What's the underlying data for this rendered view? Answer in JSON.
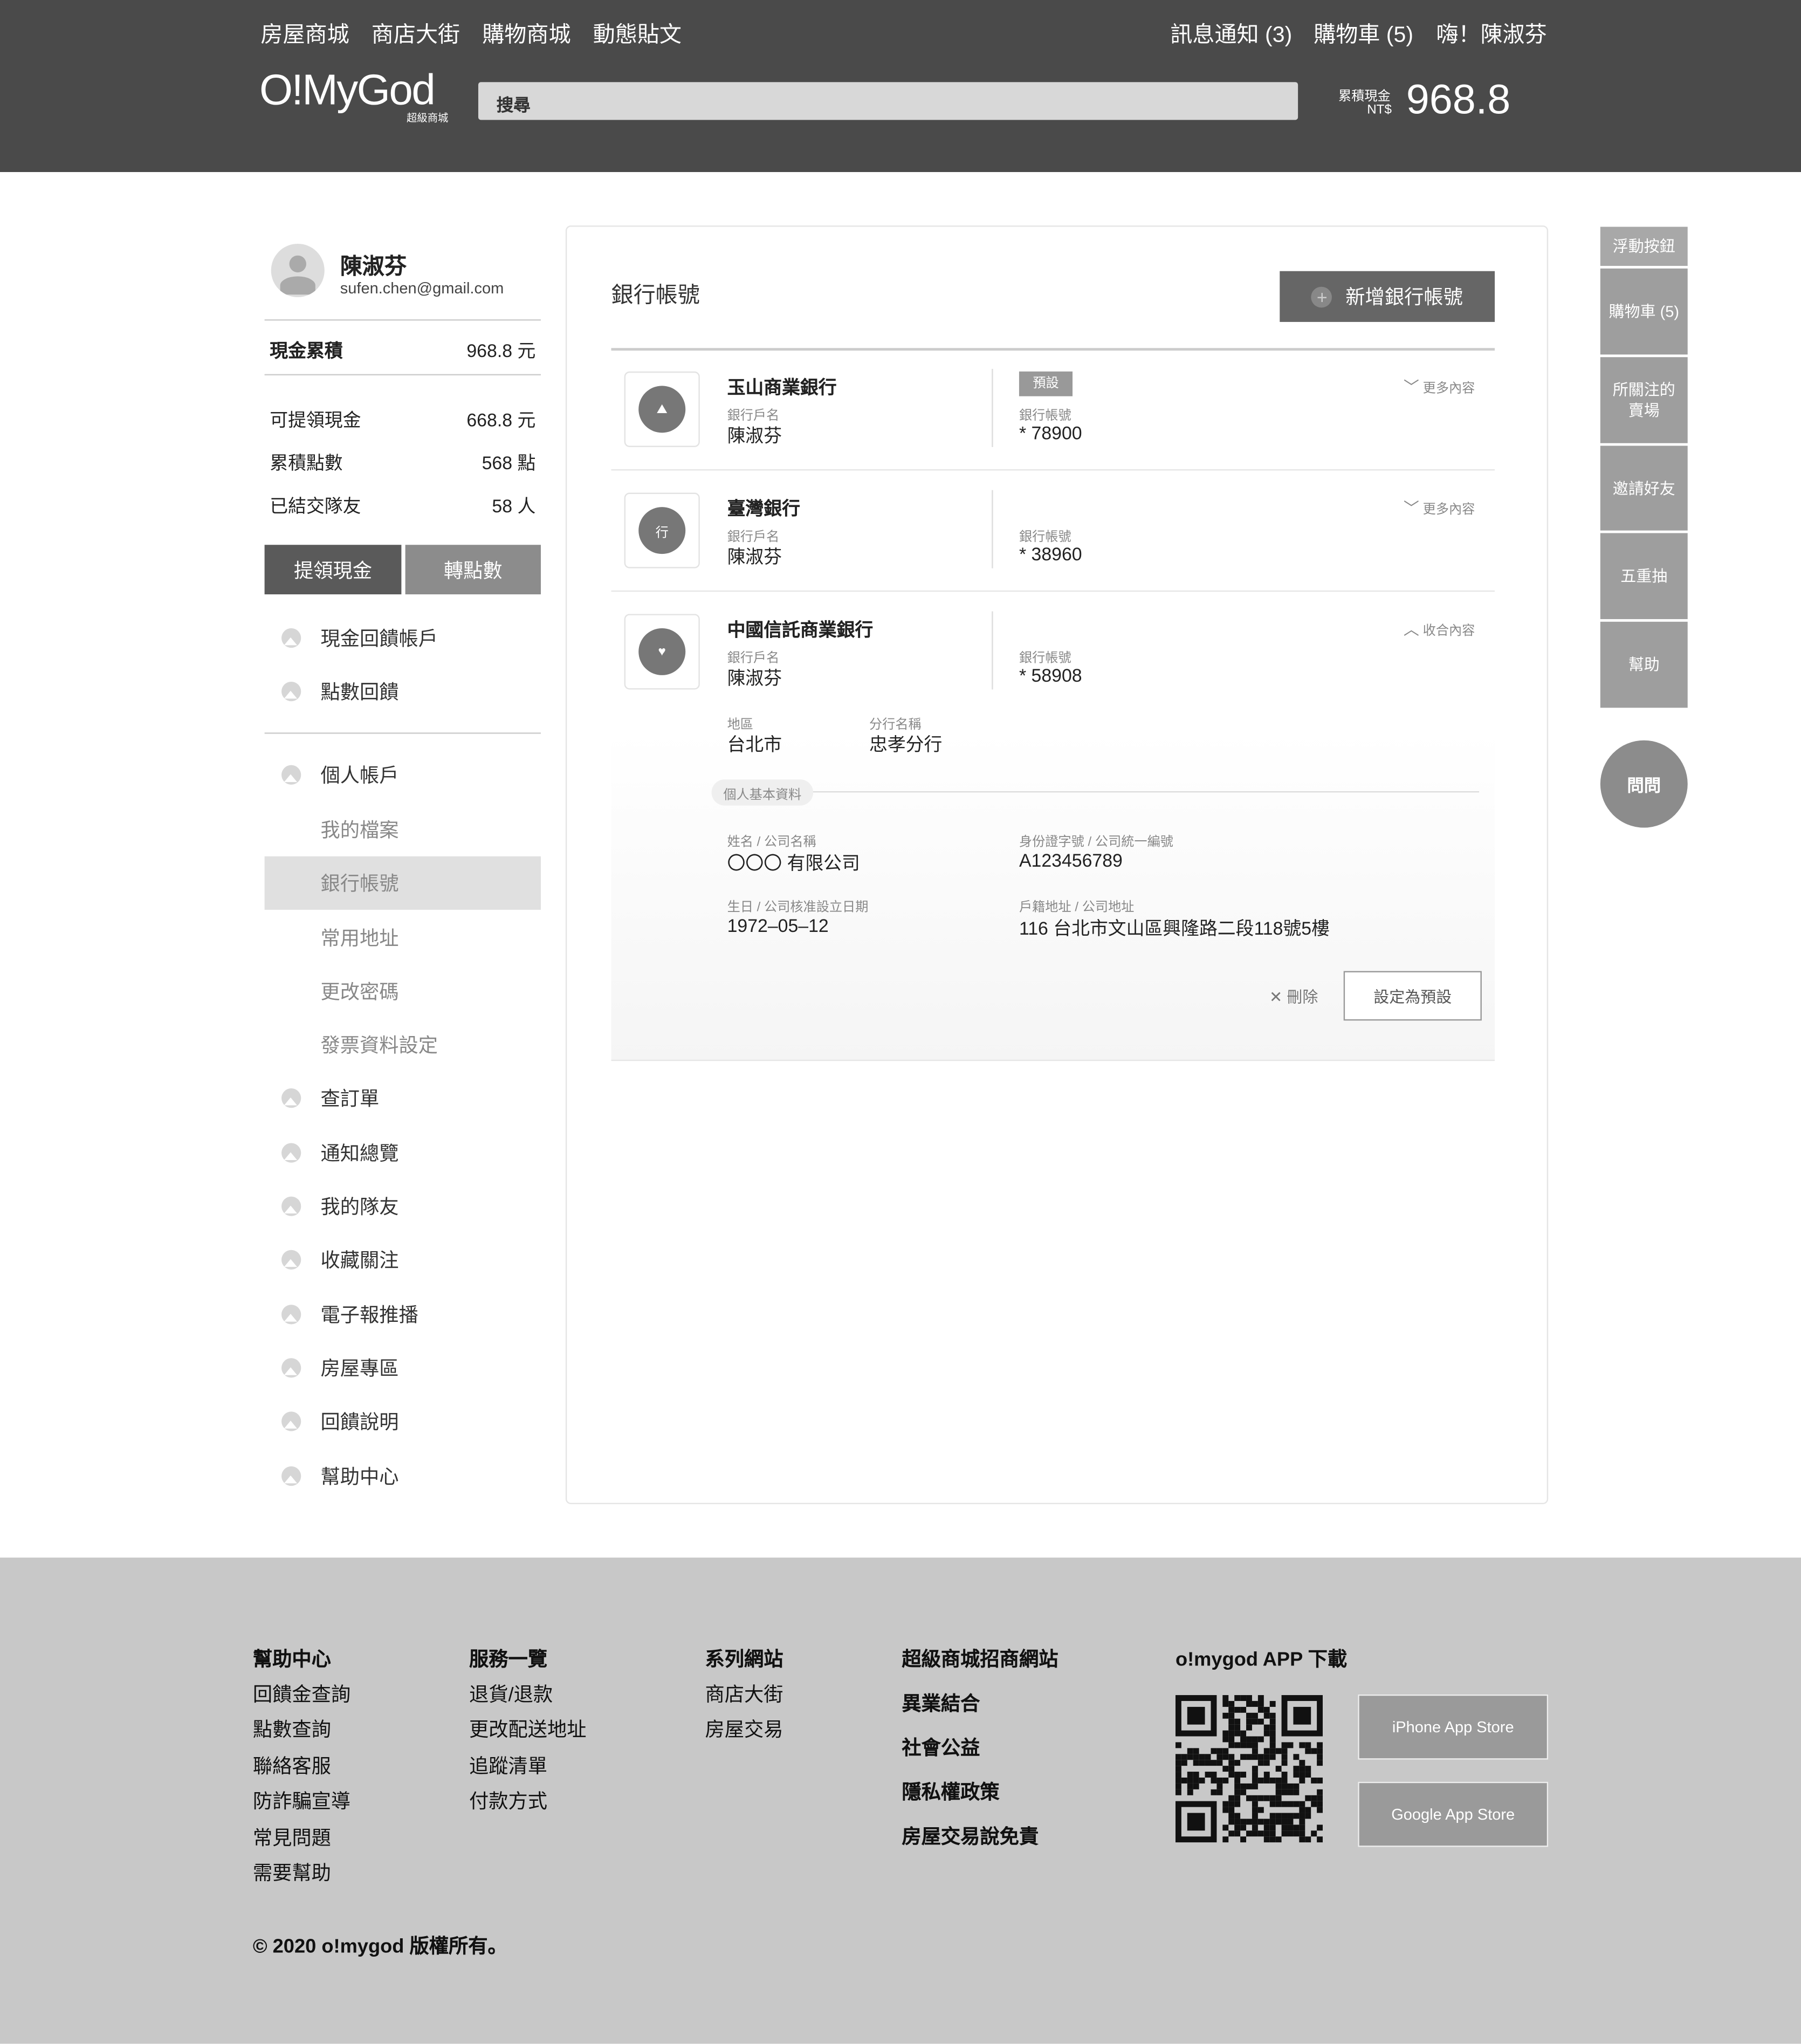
{
  "header": {
    "nav": [
      "房屋商城",
      "商店大街",
      "購物商城",
      "動態貼文"
    ],
    "notifications": "訊息通知 (3)",
    "cart": "購物車 (5)",
    "greeting": "嗨！陳淑芬",
    "logo": "O!MyGod",
    "logo_sub": "超級商城",
    "search_placeholder": "搜尋",
    "cash_label": "累積現金",
    "currency": "NT$",
    "cash_value": "968.8"
  },
  "profile": {
    "name": "陳淑芬",
    "email": "sufen.chen@gmail.com"
  },
  "stats": {
    "total": {
      "label": "現金累積",
      "value": "968.8",
      "unit": "元"
    },
    "rows": [
      {
        "label": "可提領現金",
        "value": "668.8",
        "unit": "元"
      },
      {
        "label": "累積點數",
        "value": "568",
        "unit": "點"
      },
      {
        "label": "已結交隊友",
        "value": "58",
        "unit": "人"
      }
    ]
  },
  "buttons": {
    "withdraw": "提領現金",
    "convert": "轉點數"
  },
  "menu": {
    "group1": [
      "現金回饋帳戶",
      "點數回饋"
    ],
    "account": "個人帳戶",
    "sub": [
      "我的檔案",
      "銀行帳號",
      "常用地址",
      "更改密碼",
      "發票資料設定"
    ],
    "group2": [
      "查訂單",
      "通知總覽",
      "我的隊友",
      "收藏關注",
      "電子報推播",
      "房屋專區",
      "回饋說明",
      "幫助中心"
    ]
  },
  "main": {
    "title": "銀行帳號",
    "add_button": "新增銀行帳號",
    "holder_label": "銀行戶名",
    "account_label": "銀行帳號",
    "default_badge": "預設",
    "more": "更多內容",
    "collapse": "收合內容",
    "banks": [
      {
        "name": "玉山商業銀行",
        "holder": "陳淑芬",
        "account": "* 78900"
      },
      {
        "name": "臺灣銀行",
        "holder": "陳淑芬",
        "account": "* 38960"
      },
      {
        "name": "中國信託商業銀行",
        "holder": "陳淑芬",
        "account": "* 58908"
      }
    ],
    "detail": {
      "region_label": "地區",
      "region": "台北市",
      "branch_label": "分行名稱",
      "branch": "忠孝分行",
      "section": "個人基本資料",
      "name_label": "姓名 / 公司名稱",
      "name": "〇〇〇 有限公司",
      "id_label": "身份證字號 / 公司統一編號",
      "id": "A123456789",
      "birth_label": "生日 / 公司核准設立日期",
      "birth": "1972–05–12",
      "addr_label": "戶籍地址 / 公司地址",
      "addr": "116 台北市文山區興隆路二段118號5樓",
      "delete": "刪除",
      "set_default": "設定為預設"
    }
  },
  "floating": {
    "title": "浮動按鈕",
    "items": [
      "購物車 (5)",
      "所關注的賣場",
      "邀請好友",
      "五重抽",
      "幫助"
    ],
    "ask": "問問"
  },
  "footer": {
    "col1": {
      "title": "幫助中心",
      "items": [
        "回饋金查詢",
        "點數查詢",
        "聯絡客服",
        "防詐騙宣導",
        "常見問題",
        "需要幫助"
      ]
    },
    "col2": {
      "title": "服務一覽",
      "items": [
        "退貨/退款",
        "更改配送地址",
        "追蹤清單",
        "付款方式"
      ]
    },
    "col3": {
      "title": "系列網站",
      "items": [
        "商店大街",
        "房屋交易"
      ]
    },
    "col4": [
      "超級商城招商網站",
      "異業結合",
      "社會公益",
      "隱私權政策",
      "房屋交易說免責"
    ],
    "app_title": "o!mygod APP 下載",
    "ios": "iPhone App Store",
    "android": "Google App Store",
    "copyright": "© 2020 o!mygod 版權所有。"
  }
}
